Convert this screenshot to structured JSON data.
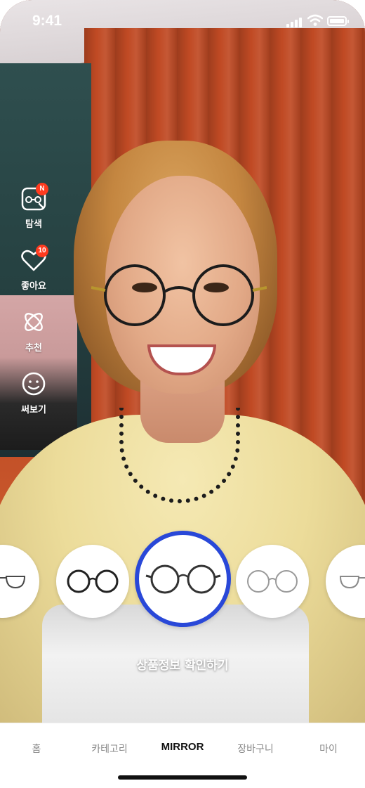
{
  "status_bar": {
    "time": "9:41"
  },
  "side_menu": {
    "items": [
      {
        "label": "탐색",
        "icon": "glasses-search-icon",
        "badge": "N"
      },
      {
        "label": "좋아요",
        "icon": "heart-icon",
        "badge": "10"
      },
      {
        "label": "추천",
        "icon": "recommend-orbit-icon",
        "badge": null
      },
      {
        "label": "써보기",
        "icon": "smiley-face-icon",
        "badge": null
      }
    ]
  },
  "carousel": {
    "selected_index": 2,
    "frames": [
      {
        "name": "frame-1",
        "style": "half-rim",
        "color": "#4a4a4a"
      },
      {
        "name": "frame-2",
        "style": "round-dark",
        "color": "#222222"
      },
      {
        "name": "frame-3",
        "style": "round-thin-dark",
        "color": "#333333"
      },
      {
        "name": "frame-4",
        "style": "round-metal",
        "color": "#9a9a9a"
      },
      {
        "name": "frame-5",
        "style": "half-rim-light",
        "color": "#8a8a8a"
      }
    ],
    "accent_color": "#2948d8"
  },
  "product_detail_label": "상품정보 확인하기",
  "tab_bar": {
    "tabs": [
      {
        "label": "홈",
        "active": false
      },
      {
        "label": "카테고리",
        "active": false
      },
      {
        "label": "MIRROR",
        "active": true
      },
      {
        "label": "장바구니",
        "active": false
      },
      {
        "label": "마이",
        "active": false
      }
    ]
  },
  "badge_color": "#ff3b1f"
}
